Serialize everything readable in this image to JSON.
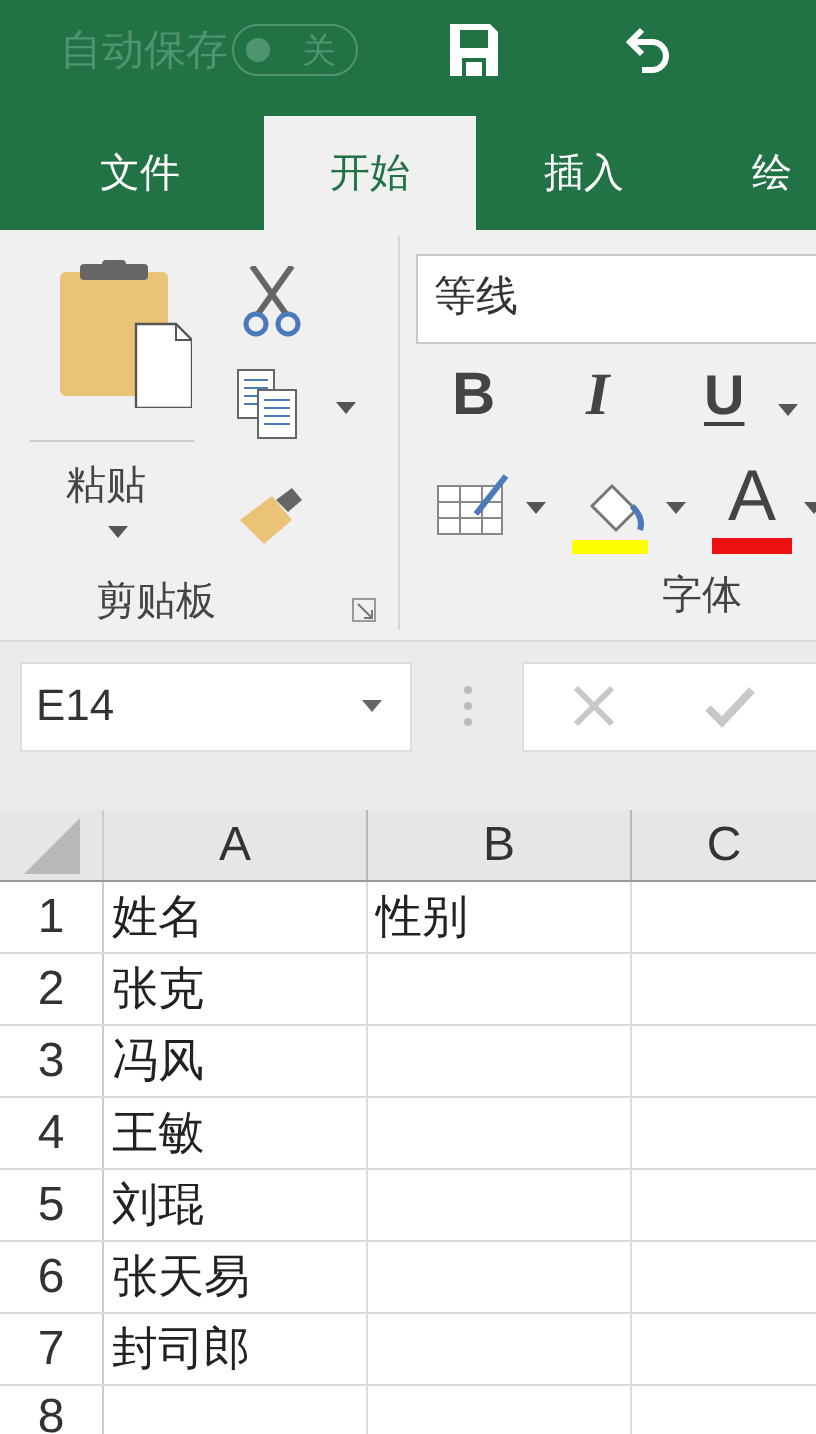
{
  "title_bar": {
    "autosave_label": "自动保存",
    "autosave_toggle": {
      "on": false,
      "label": "关"
    }
  },
  "tabs": [
    {
      "label": "文件",
      "selected": false
    },
    {
      "label": "开始",
      "selected": true
    },
    {
      "label": "插入",
      "selected": false
    },
    {
      "label": "绘",
      "selected": false
    }
  ],
  "clipboard_group": {
    "paste_label": "粘贴",
    "title": "剪贴板"
  },
  "font_group": {
    "font_name": "等线",
    "bold": "B",
    "italic": "I",
    "underline": "U",
    "font_color": "A",
    "title": "字体"
  },
  "name_box": {
    "value": "E14"
  },
  "sheet": {
    "columns": [
      "A",
      "B",
      "C"
    ],
    "rows": [
      {
        "number": "1",
        "cells": [
          "姓名",
          "性别"
        ]
      },
      {
        "number": "2",
        "cells": [
          "张克"
        ]
      },
      {
        "number": "3",
        "cells": [
          "冯风"
        ]
      },
      {
        "number": "4",
        "cells": [
          "王敏"
        ]
      },
      {
        "number": "5",
        "cells": [
          "刘琨"
        ]
      },
      {
        "number": "6",
        "cells": [
          "张天易"
        ]
      },
      {
        "number": "7",
        "cells": [
          "封司郎"
        ]
      },
      {
        "number": "8"
      }
    ]
  }
}
